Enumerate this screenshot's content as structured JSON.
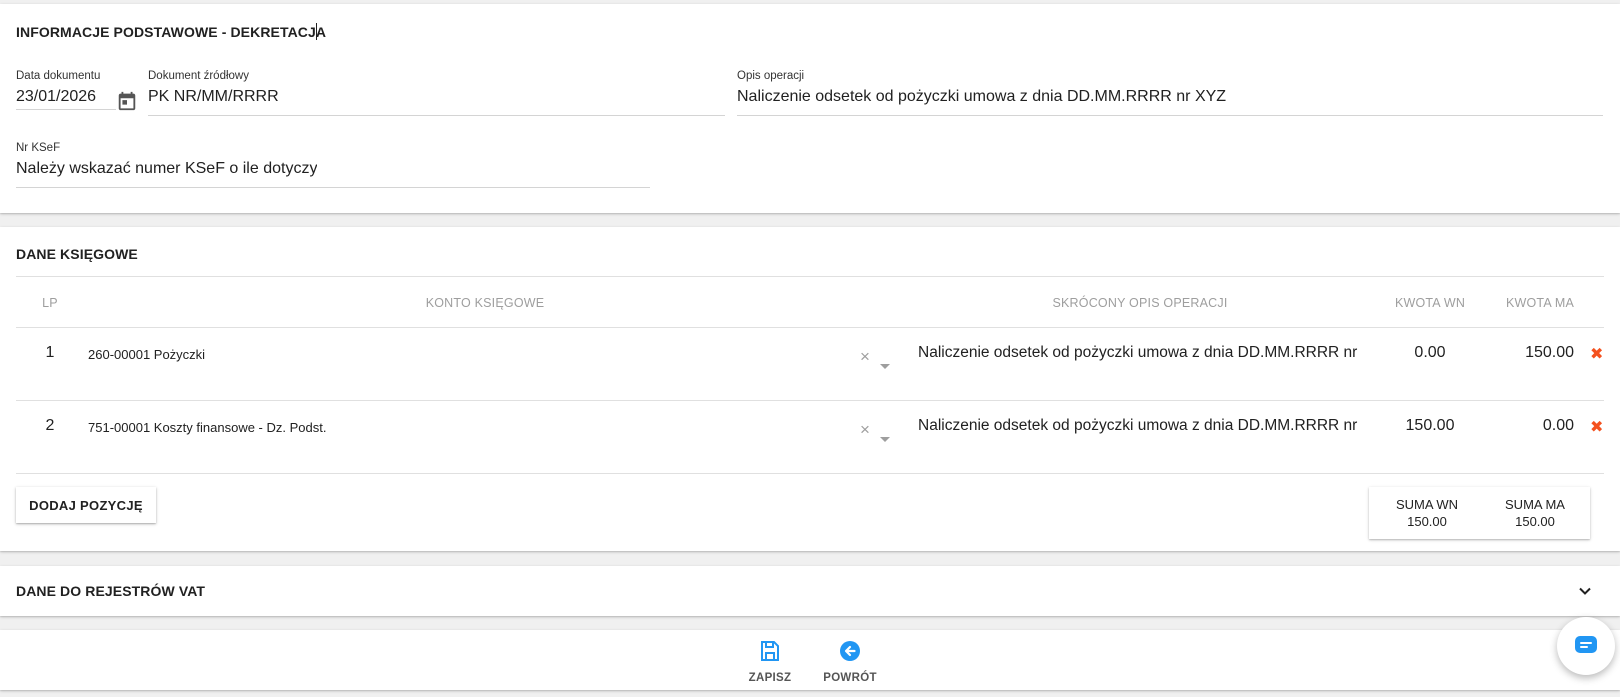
{
  "basic_info": {
    "title": "INFORMACJE PODSTAWOWE - DEKRETACJA",
    "document_date": {
      "label": "Data dokumentu",
      "value": "23/01/2026"
    },
    "source_document": {
      "label": "Dokument źródłowy",
      "value": "PK NR/MM/RRRR"
    },
    "operation_description": {
      "label": "Opis operacji",
      "value": "Naliczenie odsetek od pożyczki umowa z dnia DD.MM.RRRR nr XYZ"
    },
    "ksef_number": {
      "label": "Nr KSeF",
      "value": "Należy wskazać numer KSeF o ile dotyczy"
    }
  },
  "accounting": {
    "title": "DANE KSIĘGOWE",
    "columns": {
      "lp": "LP",
      "account": "KONTO KSIĘGOWE",
      "short_description": "SKRÓCONY OPIS OPERACJI",
      "amount_wn": "KWOTA WN",
      "amount_ma": "KWOTA MA"
    },
    "rows": [
      {
        "lp": "1",
        "account": "260-00001 Pożyczki",
        "clear": "×",
        "description": "Naliczenie odsetek od pożyczki umowa z dnia DD.MM.RRRR nr",
        "wn": "0.00",
        "ma": "150.00",
        "delete": "✖"
      },
      {
        "lp": "2",
        "account": "751-00001 Koszty finansowe - Dz. Podst.",
        "clear": "×",
        "description": "Naliczenie odsetek od pożyczki umowa z dnia DD.MM.RRRR nr",
        "wn": "150.00",
        "ma": "0.00",
        "delete": "✖"
      }
    ],
    "add_button": "DODAJ POZYCJĘ",
    "sum_wn": {
      "label": "SUMA WN",
      "value": "150.00"
    },
    "sum_ma": {
      "label": "SUMA MA",
      "value": "150.00"
    }
  },
  "vat": {
    "title": "DANE DO REJESTRÓW VAT"
  },
  "actions": {
    "save": "ZAPISZ",
    "back": "POWRÓT"
  },
  "icons": {
    "calendar": "calendar-icon",
    "delete": "close-icon",
    "expand": "chevron-down-icon",
    "save": "floppy-disk-icon",
    "back": "arrow-left-circle-icon",
    "chat": "chat-icon"
  },
  "colors": {
    "accent": "#2196f3",
    "delete": "#f4511e",
    "muted": "#9e9e9e"
  }
}
